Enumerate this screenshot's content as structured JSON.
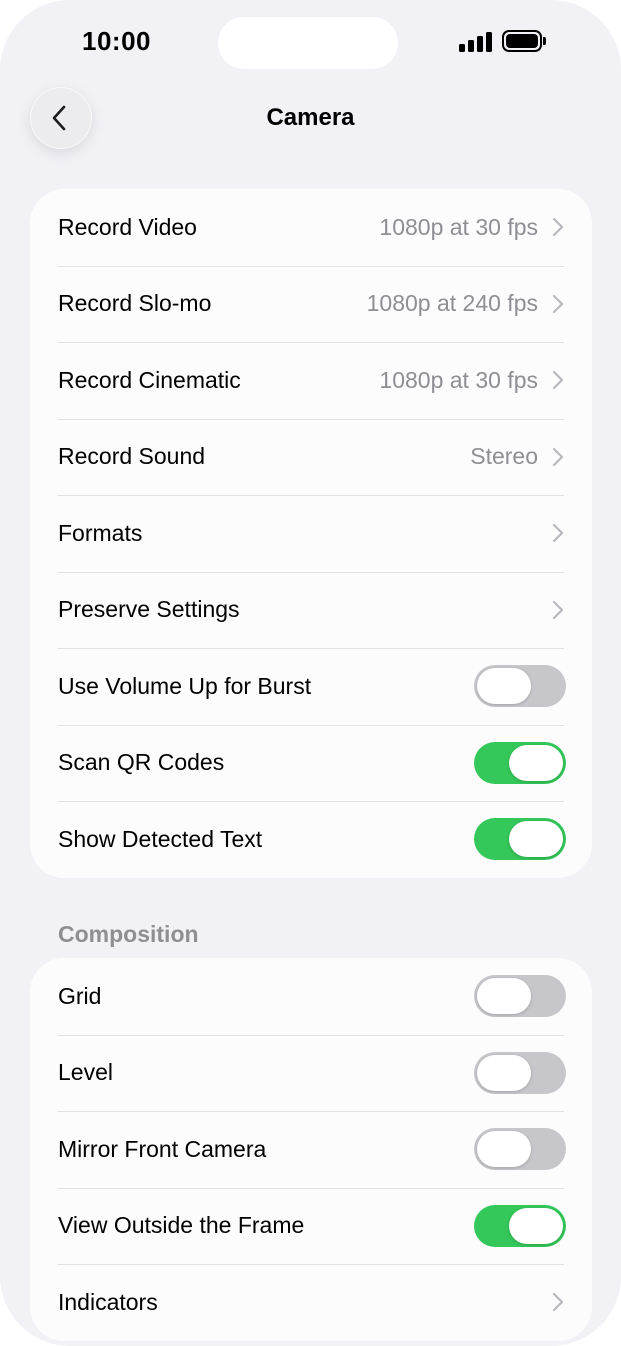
{
  "status_bar": {
    "time": "10:00"
  },
  "nav": {
    "title": "Camera",
    "back_icon": "chevron-left-icon"
  },
  "main_group": {
    "rows": [
      {
        "label": "Record Video",
        "value": "1080p at 30 fps",
        "kind": "link"
      },
      {
        "label": "Record Slo-mo",
        "value": "1080p at 240 fps",
        "kind": "link"
      },
      {
        "label": "Record Cinematic",
        "value": "1080p at 30 fps",
        "kind": "link"
      },
      {
        "label": "Record Sound",
        "value": "Stereo",
        "kind": "link"
      },
      {
        "label": "Formats",
        "value": "",
        "kind": "link"
      },
      {
        "label": "Preserve Settings",
        "value": "",
        "kind": "link"
      },
      {
        "label": "Use Volume Up for Burst",
        "kind": "toggle",
        "on": false
      },
      {
        "label": "Scan QR Codes",
        "kind": "toggle",
        "on": true
      },
      {
        "label": "Show Detected Text",
        "kind": "toggle",
        "on": true
      }
    ]
  },
  "composition_group": {
    "header": "Composition",
    "rows": [
      {
        "label": "Grid",
        "kind": "toggle",
        "on": false
      },
      {
        "label": "Level",
        "kind": "toggle",
        "on": false
      },
      {
        "label": "Mirror Front Camera",
        "kind": "toggle",
        "on": false
      },
      {
        "label": "View Outside the Frame",
        "kind": "toggle",
        "on": true
      },
      {
        "label": "Indicators",
        "value": "",
        "kind": "link"
      }
    ]
  },
  "colors": {
    "background": "#f1f1f6",
    "card": "#fcfcfd",
    "toggle_on": "#34c759",
    "toggle_off": "#c7c7cb",
    "secondary_text": "#8e8e93"
  }
}
